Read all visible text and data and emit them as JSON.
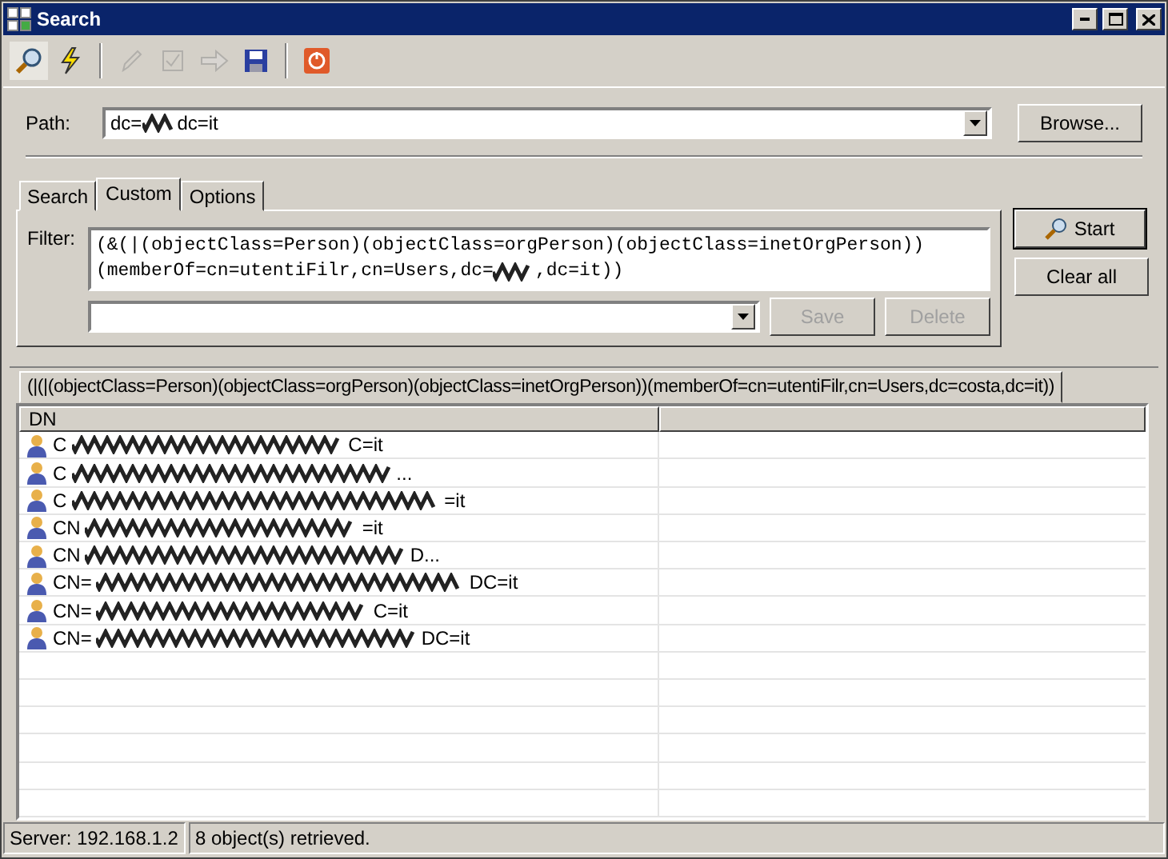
{
  "window": {
    "title": "Search"
  },
  "toolbar": [
    {
      "selected": true,
      "disabled": false
    },
    {
      "selected": false,
      "disabled": false
    },
    {
      "selected": false,
      "disabled": true
    },
    {
      "selected": false,
      "disabled": true
    },
    {
      "selected": false,
      "disabled": true
    },
    {
      "selected": false,
      "disabled": false
    },
    {
      "selected": false,
      "disabled": false
    }
  ],
  "path": {
    "label": "Path:",
    "value_start": "dc=",
    "value_end": "dc=it",
    "browse": "Browse..."
  },
  "tabs": [
    {
      "label": "Search",
      "selected": false
    },
    {
      "label": "Custom",
      "selected": true
    },
    {
      "label": "Options",
      "selected": false
    }
  ],
  "filter": {
    "label": "Filter:",
    "line_1": "(&(|(objectClass=Person)(objectClass=orgPerson)(objectClass=inetOrgPerson))",
    "line_2_start": "(memberOf=cn=utentiFilr,cn=Users,dc=",
    "line_2_end": ",dc=it))",
    "save": {
      "label": "Save",
      "disabled": true
    },
    "delete": {
      "label": "Delete",
      "disabled": true
    }
  },
  "actions": {
    "start": "Start",
    "clear": "Clear all"
  },
  "result_tab": "(|(|(objectClass=Person)(objectClass=orgPerson)(objectClass=inetOrgPerson))(memberOf=cn=utentiFilr,cn=Users,dc=costa,dc=it))",
  "table": {
    "columns": [
      "DN"
    ],
    "rows": [
      {
        "start": "C",
        "end": "C=it"
      },
      {
        "start": "C",
        "end": "..."
      },
      {
        "start": "C",
        "end": "=it"
      },
      {
        "start": "CN",
        "end": "=it"
      },
      {
        "start": "CN",
        "end": "D..."
      },
      {
        "start": "CN=",
        "end": "DC=it"
      },
      {
        "start": "CN=",
        "end": "C=it"
      },
      {
        "start": "CN=",
        "end": "DC=it"
      }
    ]
  },
  "status_bar": {
    "server": "Server: 192.168.1.2",
    "message": "8 object(s) retrieved."
  }
}
